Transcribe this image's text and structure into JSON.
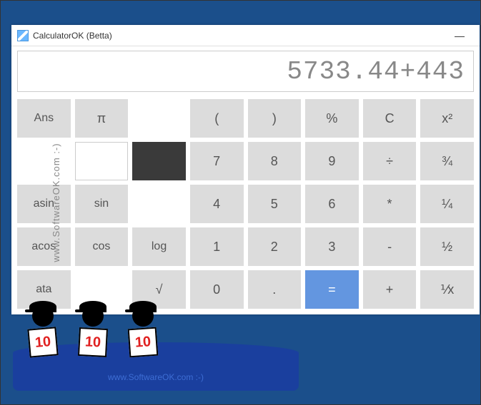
{
  "watermark": {
    "left": "www.SoftwareOK.com :-)",
    "bench": "www.SoftwareOK.com :-)"
  },
  "window": {
    "title": "CalculatorOK (Betta)",
    "minimize": "—"
  },
  "display": {
    "value": "5733.44+443"
  },
  "keys": {
    "r1c1": "Ans",
    "r1c2": "π",
    "r1c3": "",
    "r1c4": "(",
    "r1c5": ")",
    "r1c6": "%",
    "r1c7": "C",
    "r1c8": "x²",
    "r2c1": "",
    "r2c2": "",
    "r2c3": "",
    "r2c4": "7",
    "r2c5": "8",
    "r2c6": "9",
    "r2c7": "÷",
    "r2c8": "¾",
    "r3c1": "asin",
    "r3c2": "sin",
    "r3c3": "",
    "r3c4": "4",
    "r3c5": "5",
    "r3c6": "6",
    "r3c7": "*",
    "r3c8": "¼",
    "r4c1": "acos",
    "r4c2": "cos",
    "r4c3": "log",
    "r4c4": "1",
    "r4c5": "2",
    "r4c6": "3",
    "r4c7": "-",
    "r4c8": "½",
    "r5c1": "ata",
    "r5c2": "",
    "r5c3": "√",
    "r5c4": "0",
    "r5c5": ".",
    "r5c6": "=",
    "r5c7": "+",
    "r5c8": "⅟x"
  },
  "judges": {
    "score1": "10",
    "score2": "10",
    "score3": "10"
  }
}
